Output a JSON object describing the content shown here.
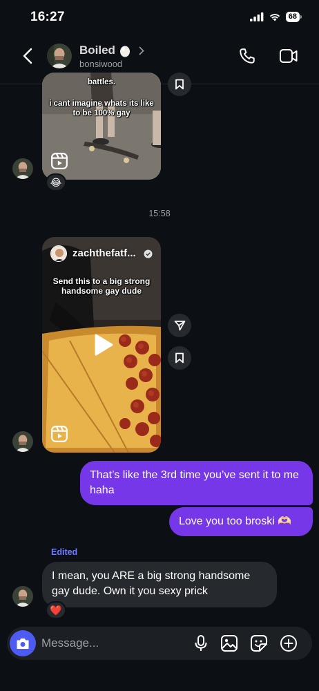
{
  "status_bar": {
    "time": "16:27",
    "battery": "68",
    "icons": [
      "signal-icon",
      "wifi-icon",
      "battery-icon"
    ]
  },
  "header": {
    "name": "Boiled",
    "name_emoji": "egg-icon",
    "username": "bonsiwood",
    "icons": [
      "back-icon",
      "chevron-right-icon",
      "phone-icon",
      "video-camera-icon"
    ]
  },
  "messages": {
    "reel_1": {
      "caption_partial": "battles.",
      "caption": "i cant imagine whats its like to be 100% gay",
      "reaction": "😂"
    },
    "timestamp": "15:58",
    "reel_2": {
      "author": "zachthefatf...",
      "caption": "Send this to a big strong handsome gay dude"
    },
    "outgoing_1": "That’s like the 3rd time you’ve sent it to me haha",
    "outgoing_2": "Love you too broski 🫶🏻",
    "edited_label": "Edited",
    "incoming_1": "I mean, you ARE a big strong handsome gay dude. Own it you sexy prick",
    "incoming_1_reaction": "❤️"
  },
  "composer": {
    "placeholder": "Message...",
    "icons": [
      "camera-icon",
      "microphone-icon",
      "gallery-icon",
      "sticker-icon",
      "plus-icon"
    ]
  },
  "colors": {
    "background": "#0c1014",
    "outgoing_bubble": "#7637e9",
    "incoming_bubble": "#26292e",
    "camera_button": "#4e5bf2",
    "edited_label": "#6e7cff"
  }
}
